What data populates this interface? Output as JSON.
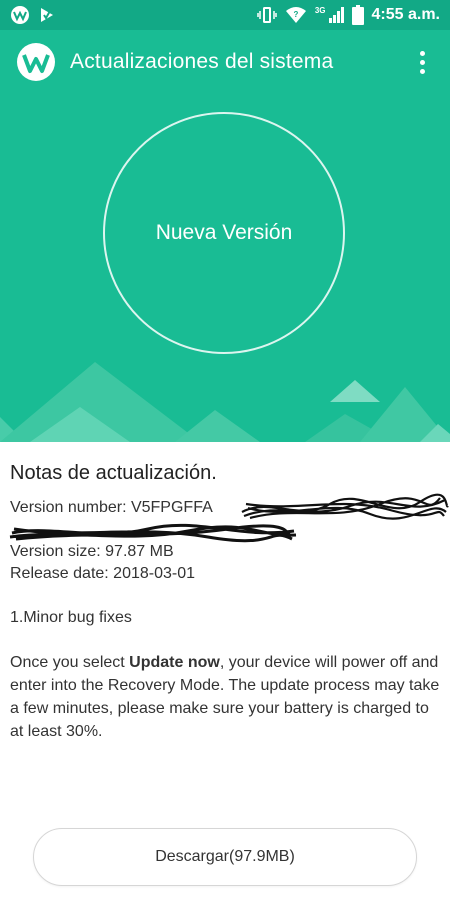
{
  "status_bar": {
    "time": "4:55 a.m.",
    "network_type": "3G",
    "icons": [
      "app-logo-icon",
      "check-flag-icon",
      "vibrate-icon",
      "wifi-icon",
      "signal-icon",
      "battery-icon"
    ]
  },
  "header": {
    "title": "Actualizaciones del sistema",
    "menu_icon": "more-vert-icon"
  },
  "hero": {
    "circle_label": "Nueva Versión"
  },
  "notes": {
    "title": "Notas de actualización.",
    "version_number_label": "Version number: V5FPGFFA",
    "version_size": "Version size: 97.87 MB",
    "release_date": "Release date: 2018-03-01",
    "changes": "1.Minor bug fixes",
    "instruction_prefix": "Once you select ",
    "instruction_bold": "Update now",
    "instruction_suffix": ", your device will power off and enter into the Recovery Mode. The update process may take a few minutes, please make sure your battery is charged to at least 30%."
  },
  "download_button": {
    "label": "Descargar(97.9MB)"
  },
  "colors": {
    "primary": "#19bc94",
    "status_bar": "#12a986",
    "text": "#333333"
  }
}
